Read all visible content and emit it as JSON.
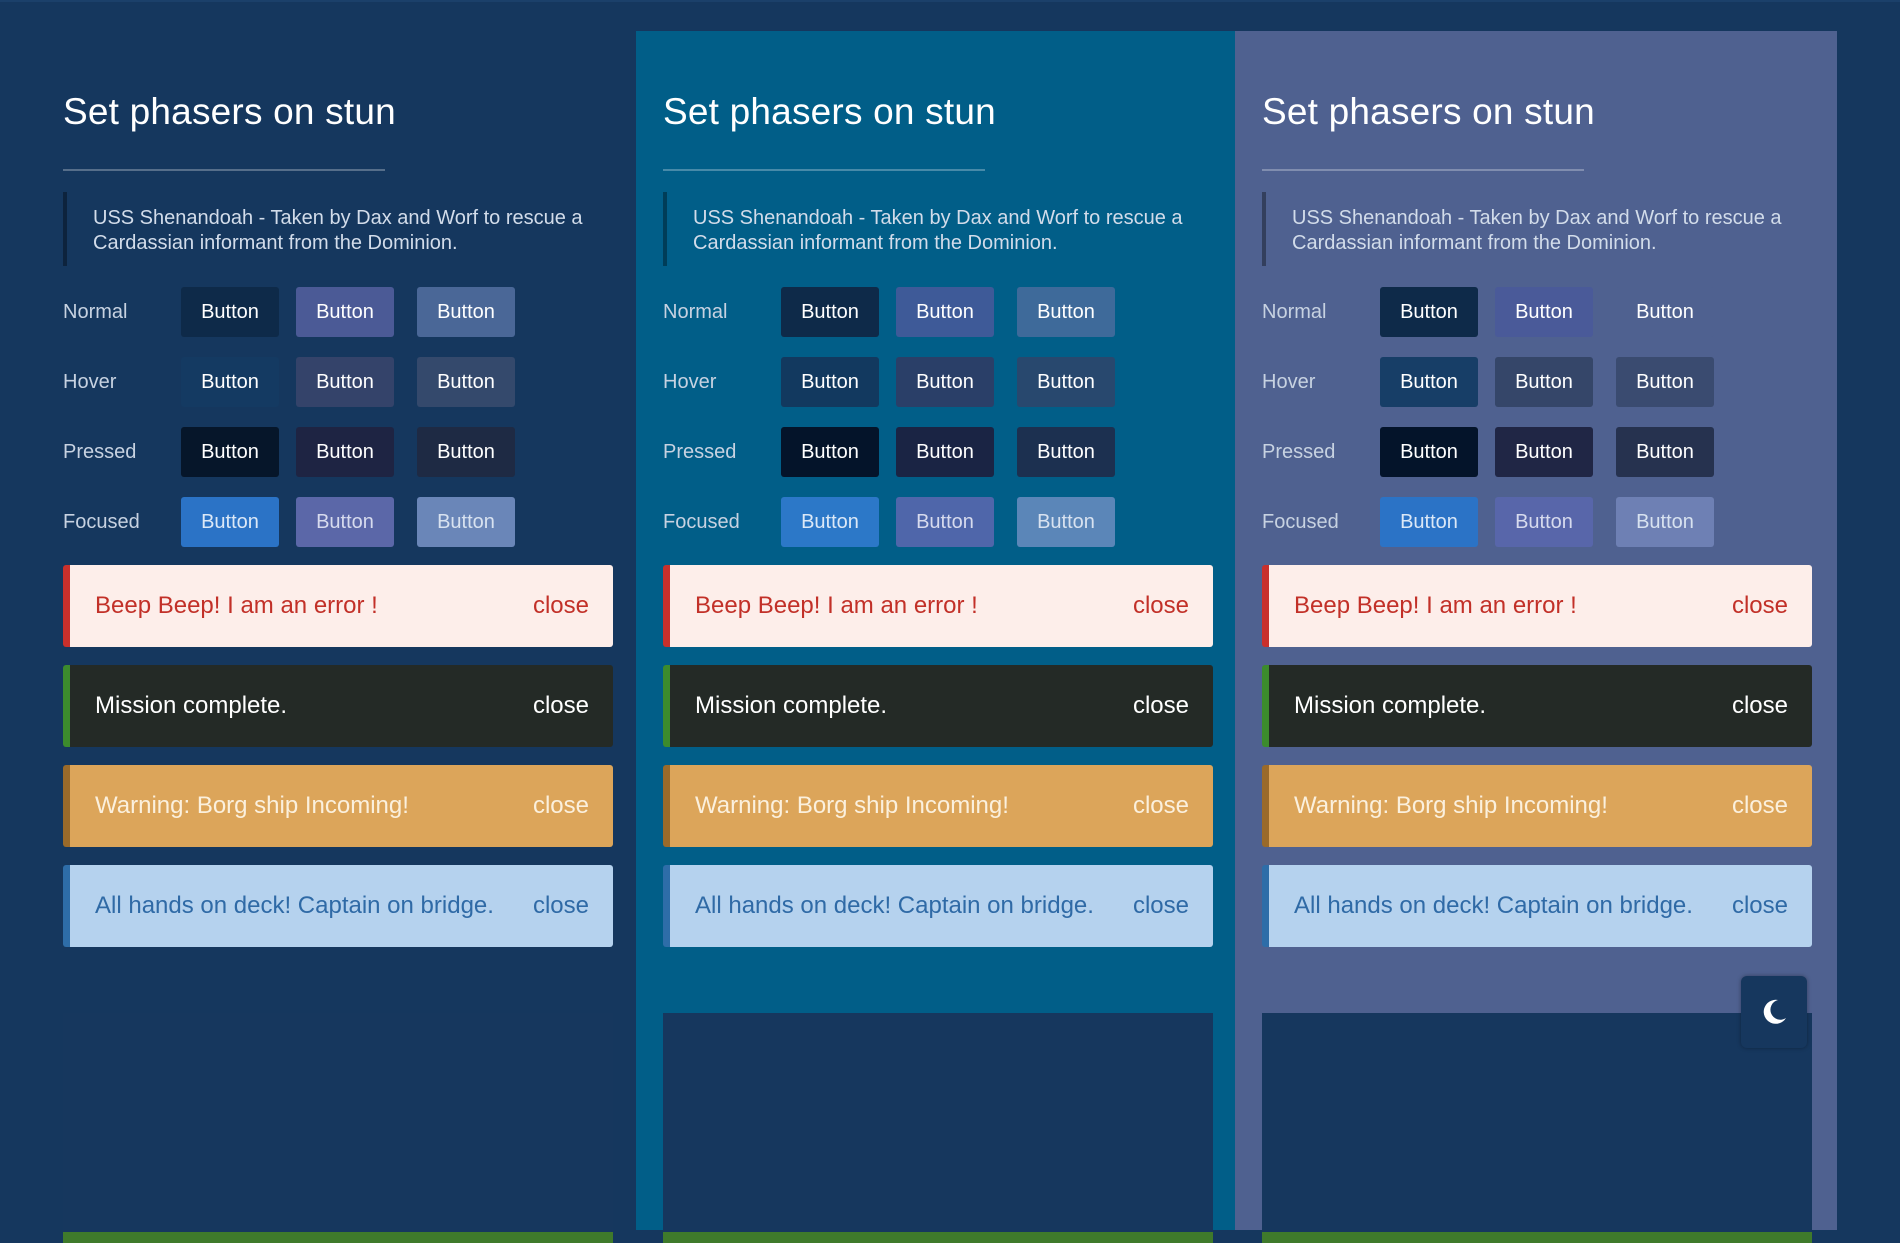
{
  "colors": {
    "page_bg": "#15375e",
    "panel_backgrounds": [
      "#15375e",
      "#015e88",
      "#4f6190"
    ],
    "error": "#c9302c",
    "success": "#3c8b2d",
    "warning": "#dca55a",
    "info": "#b5d2ee"
  },
  "panels": [
    {
      "title": "Set phasers on stun",
      "quote": "USS Shenandoah - Taken by Dax and Worf to rescue a Cardassian informant from the Dominion.",
      "states": [
        {
          "label": "Normal",
          "buttons": [
            "Button",
            "Button",
            "Button"
          ]
        },
        {
          "label": "Hover",
          "buttons": [
            "Button",
            "Button",
            "Button"
          ]
        },
        {
          "label": "Pressed",
          "buttons": [
            "Button",
            "Button",
            "Button"
          ]
        },
        {
          "label": "Focused",
          "buttons": [
            "Button",
            "Button",
            "Button"
          ]
        }
      ],
      "alerts": [
        {
          "type": "error",
          "message": "Beep Beep! I am an error !",
          "close": "close"
        },
        {
          "type": "success",
          "message": "Mission complete.",
          "close": "close"
        },
        {
          "type": "warning",
          "message": "Warning: Borg ship Incoming!",
          "close": "close"
        },
        {
          "type": "info",
          "message": "All hands on deck! Captain on bridge.",
          "close": "close"
        }
      ]
    },
    {
      "title": "Set phasers on stun",
      "quote": "USS Shenandoah - Taken by Dax and Worf to rescue a Cardassian informant from the Dominion.",
      "states": [
        {
          "label": "Normal",
          "buttons": [
            "Button",
            "Button",
            "Button"
          ]
        },
        {
          "label": "Hover",
          "buttons": [
            "Button",
            "Button",
            "Button"
          ]
        },
        {
          "label": "Pressed",
          "buttons": [
            "Button",
            "Button",
            "Button"
          ]
        },
        {
          "label": "Focused",
          "buttons": [
            "Button",
            "Button",
            "Button"
          ]
        }
      ],
      "alerts": [
        {
          "type": "error",
          "message": "Beep Beep! I am an error !",
          "close": "close"
        },
        {
          "type": "success",
          "message": "Mission complete.",
          "close": "close"
        },
        {
          "type": "warning",
          "message": "Warning: Borg ship Incoming!",
          "close": "close"
        },
        {
          "type": "info",
          "message": "All hands on deck! Captain on bridge.",
          "close": "close"
        }
      ]
    },
    {
      "title": "Set phasers on stun",
      "quote": "USS Shenandoah - Taken by Dax and Worf to rescue a Cardassian informant from the Dominion.",
      "states": [
        {
          "label": "Normal",
          "buttons": [
            "Button",
            "Button",
            "Button"
          ]
        },
        {
          "label": "Hover",
          "buttons": [
            "Button",
            "Button",
            "Button"
          ]
        },
        {
          "label": "Pressed",
          "buttons": [
            "Button",
            "Button",
            "Button"
          ]
        },
        {
          "label": "Focused",
          "buttons": [
            "Button",
            "Button",
            "Button"
          ]
        }
      ],
      "alerts": [
        {
          "type": "error",
          "message": "Beep Beep! I am an error !",
          "close": "close"
        },
        {
          "type": "success",
          "message": "Mission complete.",
          "close": "close"
        },
        {
          "type": "warning",
          "message": "Warning: Borg ship Incoming!",
          "close": "close"
        },
        {
          "type": "info",
          "message": "All hands on deck! Captain on bridge.",
          "close": "close"
        }
      ]
    }
  ],
  "theme_toggle": {
    "icon": "moon-icon"
  }
}
